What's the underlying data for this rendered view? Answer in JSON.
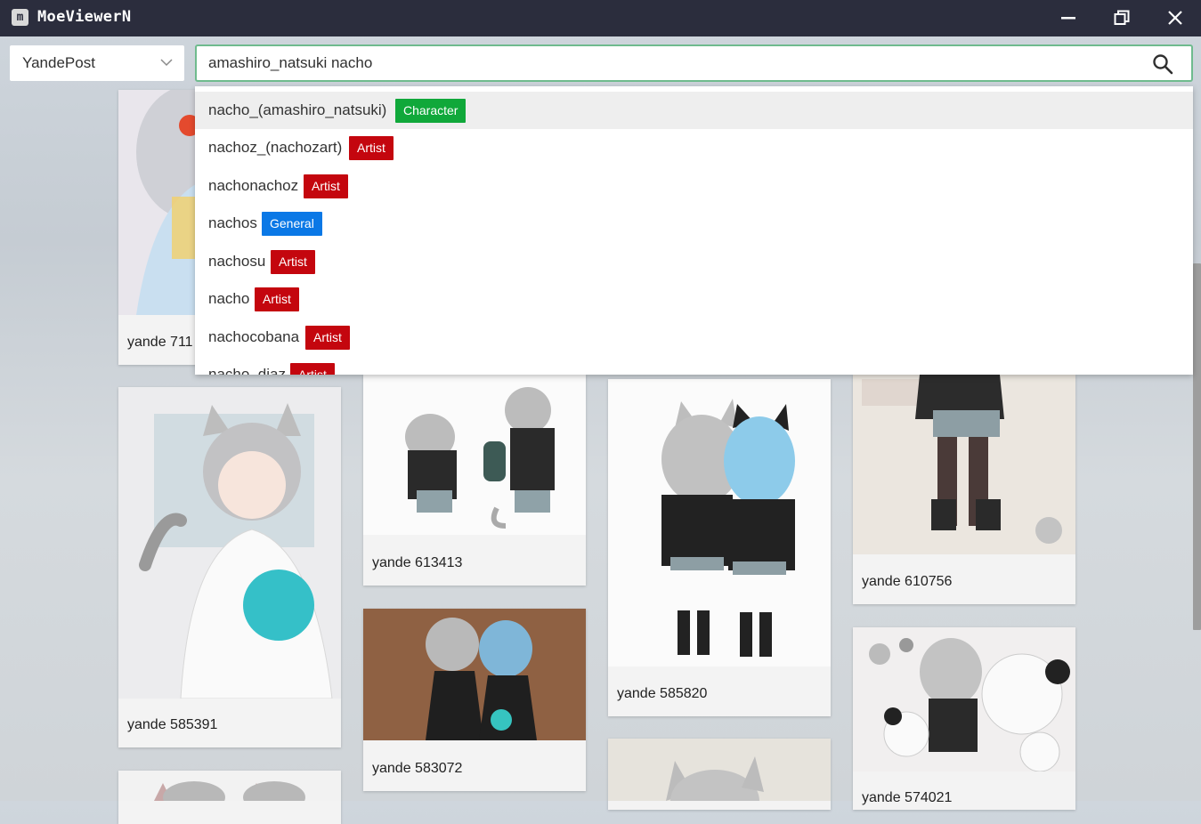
{
  "window": {
    "title": "MoeViewerN",
    "icon_letter": "m",
    "controls": [
      "minimize-icon",
      "restore-icon",
      "close-icon"
    ]
  },
  "toolbar": {
    "site_selected": "YandePost",
    "search_value": "amashiro_natsuki nacho",
    "search_placeholder": ""
  },
  "colors": {
    "titlebar": "#2b2d3d",
    "search_border": "#6fbb8e",
    "Character": "#10a83a",
    "Artist": "#c4060e",
    "General": "#0a78e6"
  },
  "suggestions": [
    {
      "name": "nacho_(amashiro_natsuki)",
      "tag": "Character"
    },
    {
      "name": "nachoz_(nachozart)",
      "tag": "Artist"
    },
    {
      "name": "nachonachoz",
      "tag": "Artist"
    },
    {
      "name": "nachos",
      "tag": "General"
    },
    {
      "name": "nachosu",
      "tag": "Artist"
    },
    {
      "name": "nacho",
      "tag": "Artist"
    },
    {
      "name": "nachocobana",
      "tag": "Artist"
    },
    {
      "name": "nacho_diaz",
      "tag": "Artist"
    }
  ],
  "cards": [
    {
      "label": "yande 711",
      "art": "card-1"
    },
    {
      "label": "yande 585391",
      "art": "card-2"
    },
    {
      "label": "",
      "art": "card-3"
    },
    {
      "label": "yande 613413",
      "art": "card-4"
    },
    {
      "label": "yande 583072",
      "art": "card-5"
    },
    {
      "label": "yande 585820",
      "art": "card-6"
    },
    {
      "label": "",
      "art": "card-7"
    },
    {
      "label": "yande 610756",
      "art": "card-8"
    },
    {
      "label": "yande 574021",
      "art": "card-9"
    }
  ]
}
